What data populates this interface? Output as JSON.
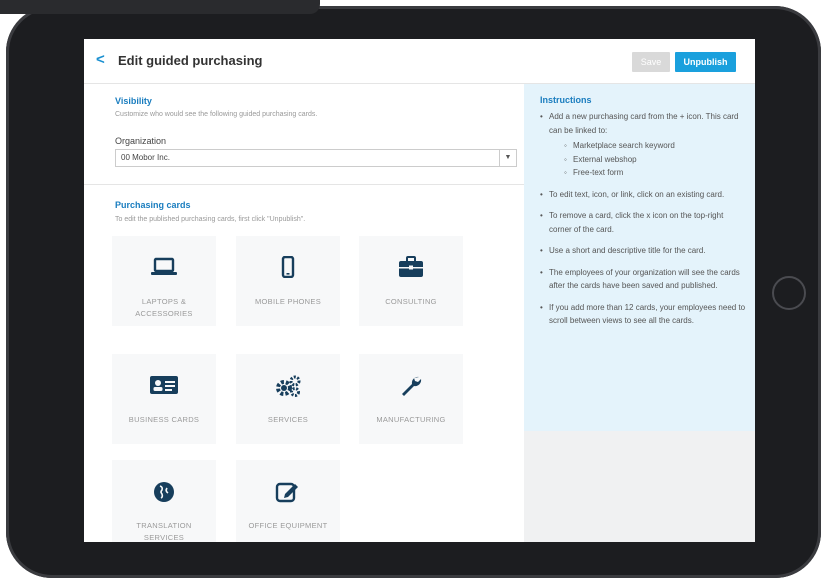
{
  "header": {
    "back_icon": "chevron-left-icon",
    "title": "Edit guided purchasing",
    "save_label": "Save",
    "unpublish_label": "Unpublish",
    "save_color": "#d9d9d9",
    "unpublish_color": "#1aa0dd"
  },
  "visibility": {
    "title": "Visibility",
    "description": "Customize who would see the following guided purchasing cards.",
    "org_label": "Organization",
    "org_value": "00 Mobor Inc."
  },
  "purchasing_cards": {
    "title": "Purchasing cards",
    "description": "To edit the published purchasing cards, first click \"Unpublish\".",
    "cards": [
      {
        "label": "LAPTOPS & ACCESSORIES",
        "icon": "laptop-icon"
      },
      {
        "label": "MOBILE PHONES",
        "icon": "mobile-phone-icon"
      },
      {
        "label": "CONSULTING",
        "icon": "briefcase-icon"
      },
      {
        "label": "BUSINESS CARDS",
        "icon": "id-card-icon"
      },
      {
        "label": "SERVICES",
        "icon": "gears-icon"
      },
      {
        "label": "MANUFACTURING",
        "icon": "wrench-icon"
      },
      {
        "label": "TRANSLATION SERVICES",
        "icon": "globe-icon"
      },
      {
        "label": "OFFICE EQUIPMENT",
        "icon": "edit-icon"
      }
    ]
  },
  "instructions": {
    "title": "Instructions",
    "item1": "Add a new purchasing card from the + icon. This card can be linked to:",
    "sub1": "Marketplace search keyword",
    "sub2": "External webshop",
    "sub3": "Free-text form",
    "item2": "To edit text, icon, or link, click on an existing card.",
    "item3": "To remove a card, click the x icon on the top-right corner of the card.",
    "item4": "Use a short and descriptive title for the card.",
    "item5": "The employees of your organization will see the cards after the cards have been saved and published.",
    "item6": "If you add more than 12 cards, your employees need to scroll between views to see all the cards."
  },
  "colors": {
    "accent": "#1a7dbf",
    "icon": "#173e5c",
    "instructions_bg": "#e4f3fb"
  }
}
